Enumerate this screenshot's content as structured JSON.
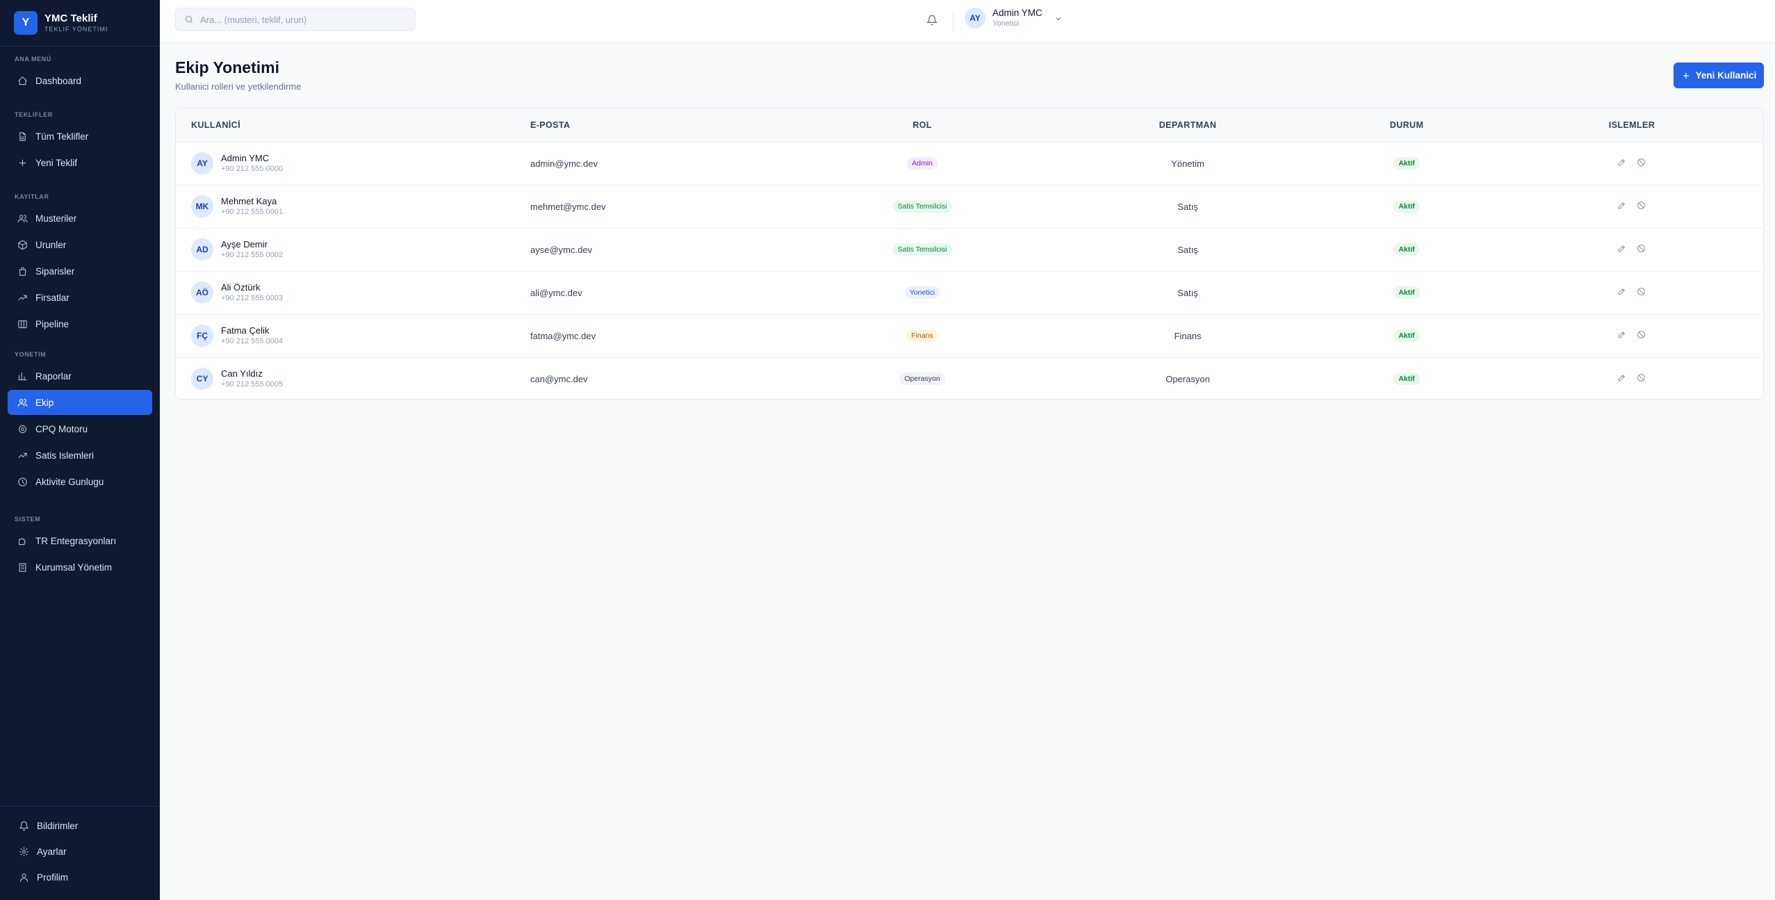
{
  "brand": {
    "logo": "Y",
    "title": "YMC Teklif",
    "subtitle": "TEKLIF YÖNETIMI"
  },
  "sidebar": {
    "sections": [
      {
        "label": "ANA MENÜ",
        "items": [
          {
            "label": "Dashboard",
            "icon": "home-icon"
          }
        ]
      },
      {
        "label": "TEKLIFLER",
        "items": [
          {
            "label": "Tüm Teklifler",
            "icon": "file-icon"
          },
          {
            "label": "Yeni Teklif",
            "icon": "plus-icon"
          }
        ]
      },
      {
        "label": "KAYITLAR",
        "items": [
          {
            "label": "Musteriler",
            "icon": "users-icon"
          },
          {
            "label": "Urunler",
            "icon": "box-icon"
          },
          {
            "label": "Siparisler",
            "icon": "bag-icon"
          },
          {
            "label": "Firsatlar",
            "icon": "trend-icon"
          },
          {
            "label": "Pipeline",
            "icon": "columns-icon"
          }
        ]
      },
      {
        "label": "YONETIM",
        "items": [
          {
            "label": "Raporlar",
            "icon": "bar-chart-icon"
          },
          {
            "label": "Ekip",
            "icon": "team-icon",
            "active": true
          },
          {
            "label": "CPQ Motoru",
            "icon": "settings-icon"
          },
          {
            "label": "Satis Islemleri",
            "icon": "trend-icon"
          },
          {
            "label": "Aktivite Gunlugu",
            "icon": "clock-icon"
          }
        ]
      },
      {
        "label": "SISTEM",
        "items": [
          {
            "label": "TR Entegrasyonları",
            "icon": "puzzle-icon"
          },
          {
            "label": "Kurumsal Yönetim",
            "icon": "building-icon"
          }
        ]
      }
    ],
    "bottom": [
      {
        "label": "Bildirimler",
        "icon": "bell-icon"
      },
      {
        "label": "Ayarlar",
        "icon": "gear-icon"
      },
      {
        "label": "Profilim",
        "icon": "user-icon"
      }
    ]
  },
  "topbar": {
    "search_placeholder": "Ara... (musteri, teklif, urun)",
    "user": {
      "initials": "AY",
      "name": "Admin YMC",
      "role": "Yonetici"
    }
  },
  "page": {
    "title": "Ekip Yonetimi",
    "subtitle": "Kullanici rolleri ve yetkilendirme",
    "new_button": "Yeni Kullanici"
  },
  "table": {
    "headers": [
      "KULLANİCİ",
      "E-POSTA",
      "ROL",
      "DEPARTMAN",
      "DURUM",
      "ISLEMLER"
    ],
    "rows": [
      {
        "initials": "AY",
        "name": "Admin YMC",
        "phone": "+90 212 555 0000",
        "email": "admin@ymc.dev",
        "role": "Admin",
        "role_style": "b-admin",
        "department": "Yönetim",
        "status": "Aktif"
      },
      {
        "initials": "MK",
        "name": "Mehmet Kaya",
        "phone": "+90 212 555 0001",
        "email": "mehmet@ymc.dev",
        "role": "Satis Temsilcisi",
        "role_style": "b-sales",
        "department": "Satış",
        "status": "Aktif"
      },
      {
        "initials": "AD",
        "name": "Ayşe Demir",
        "phone": "+90 212 555 0002",
        "email": "ayse@ymc.dev",
        "role": "Satis Temsilcisi",
        "role_style": "b-sales",
        "department": "Satış",
        "status": "Aktif"
      },
      {
        "initials": "AÖ",
        "name": "Ali Öztürk",
        "phone": "+90 212 555 0003",
        "email": "ali@ymc.dev",
        "role": "Yonetici",
        "role_style": "b-manager",
        "department": "Satış",
        "status": "Aktif"
      },
      {
        "initials": "FÇ",
        "name": "Fatma Çelik",
        "phone": "+90 212 555 0004",
        "email": "fatma@ymc.dev",
        "role": "Finans",
        "role_style": "b-finance",
        "department": "Finans",
        "status": "Aktif"
      },
      {
        "initials": "CY",
        "name": "Can Yıldız",
        "phone": "+90 212 555 0005",
        "email": "can@ymc.dev",
        "role": "Operasyon",
        "role_style": "b-ops",
        "department": "Operasyon",
        "status": "Aktif"
      }
    ]
  },
  "colors": {
    "accent": "#2563eb",
    "sidebar_bg": "#0f1a30",
    "active_badge": "#15803d"
  }
}
